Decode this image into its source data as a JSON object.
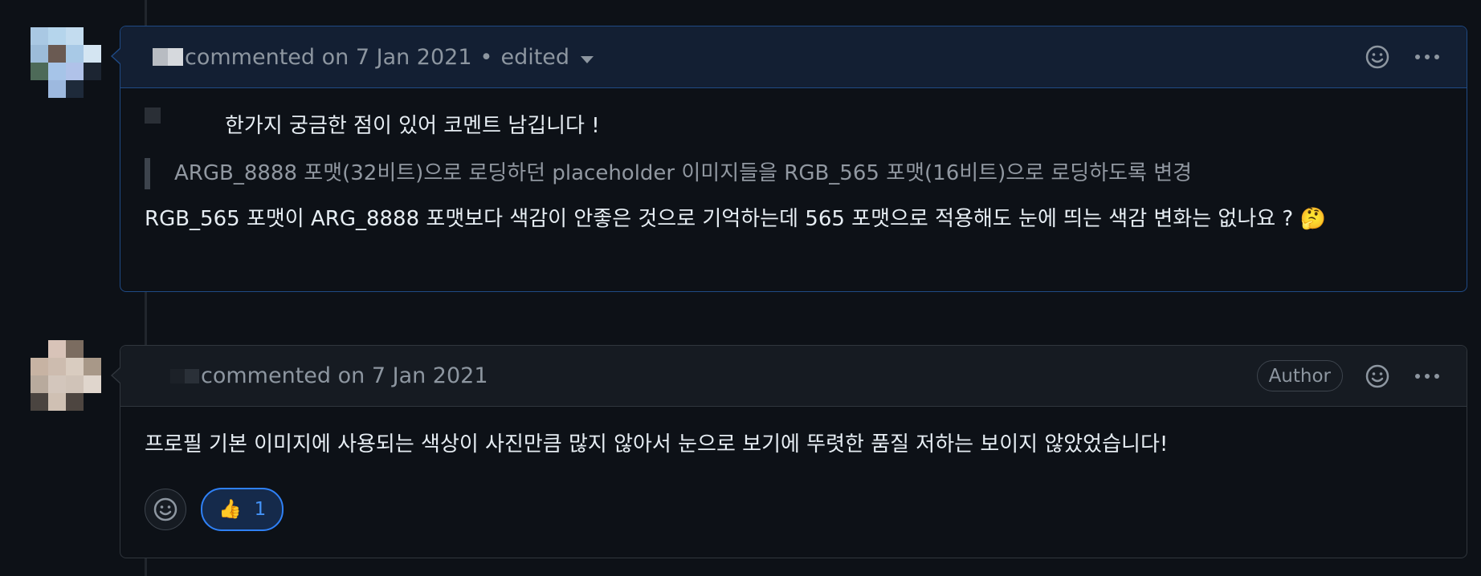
{
  "comments": [
    {
      "header": {
        "action": "commented on",
        "date": "7 Jan 2021",
        "separator": "•",
        "edited": "edited"
      },
      "body": {
        "intro": "한가지 궁금한 점이 있어 코멘트 남깁니다 !",
        "quote": "ARGB_8888 포맷(32비트)으로 로딩하던 placeholder 이미지들을 RGB_565 포맷(16비트)으로 로딩하도록 변경",
        "text": "RGB_565 포맷이 ARG_8888 포맷보다 색감이 안좋은 것으로 기억하는데 565 포맷으로 적용해도 눈에 띄는 색감 변화는 없나요 ?",
        "emoji": "🤔"
      }
    },
    {
      "header": {
        "action": "commented on",
        "date": "7 Jan 2021",
        "badge": "Author"
      },
      "body": {
        "text": "프로필 기본 이미지에 사용되는 색상이 사진만큼 많지 않아서 눈으로 보기에 뚜렷한 품질 저하는 보이지 않았었습니다!"
      },
      "reactions": [
        {
          "emoji": "👍",
          "count": "1"
        }
      ]
    }
  ],
  "colors": {
    "accent": "#2f81f7",
    "background": "#0d1117",
    "border": "#30363d"
  },
  "icons": [
    "smiley-icon",
    "kebab-icon",
    "chevron-down-icon",
    "thumbs-up-icon",
    "add-reaction-icon"
  ]
}
